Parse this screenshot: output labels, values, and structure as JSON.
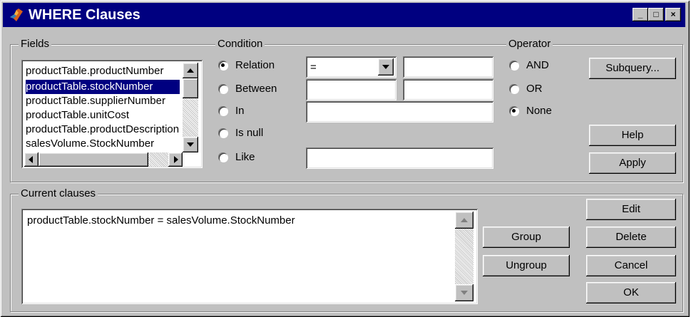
{
  "window": {
    "title": "WHERE Clauses"
  },
  "titlebar_buttons": {
    "minimize": "_",
    "maximize": "□",
    "close": "×"
  },
  "fields": {
    "label": "Fields",
    "items": [
      "productTable.productNumber",
      "productTable.stockNumber",
      "productTable.supplierNumber",
      "productTable.unitCost",
      "productTable.productDescription",
      "salesVolume.StockNumber"
    ],
    "selected_index": 1
  },
  "condition": {
    "label": "Condition",
    "options": [
      "Relation",
      "Between",
      "In",
      "Is null",
      "Like"
    ],
    "selected": "Relation",
    "relation_operator": "=",
    "relation_value": "",
    "between_low": "",
    "between_high": "",
    "in_value": "",
    "like_value": ""
  },
  "operator": {
    "label": "Operator",
    "options": [
      "AND",
      "OR",
      "None"
    ],
    "selected": "None"
  },
  "buttons": {
    "subquery": "Subquery...",
    "help": "Help",
    "apply": "Apply",
    "group": "Group",
    "ungroup": "Ungroup",
    "edit": "Edit",
    "delete": "Delete",
    "cancel": "Cancel",
    "ok": "OK"
  },
  "current_clauses": {
    "label": "Current clauses",
    "items": [
      "productTable.stockNumber = salesVolume.StockNumber"
    ]
  },
  "colors": {
    "titlebar": "#000080",
    "selection": "#000080",
    "face": "#c0c0c0"
  }
}
